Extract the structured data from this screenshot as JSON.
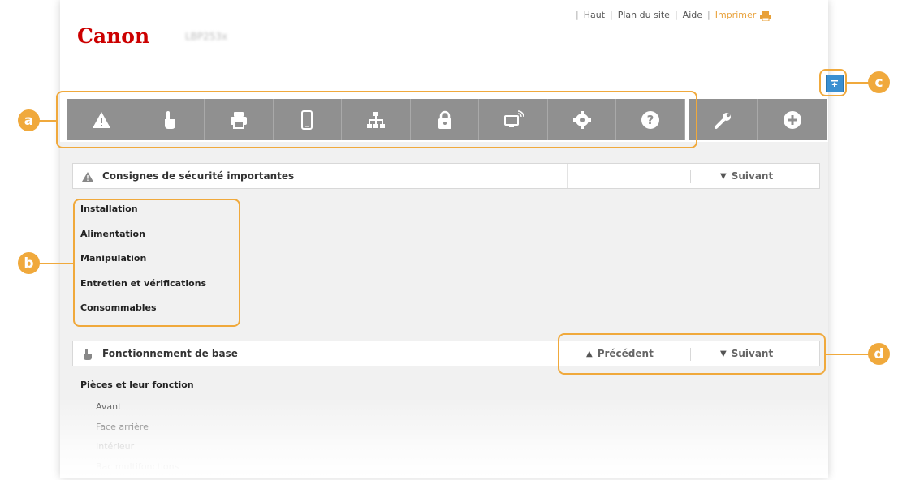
{
  "header": {
    "logo": "Canon",
    "model": "LBP253x",
    "links": [
      "Haut",
      "Plan du site",
      "Aide"
    ],
    "print_label": "Imprimer"
  },
  "toolbar": {
    "icons": [
      "warning-icon",
      "hand-pointer-icon",
      "printer-icon",
      "smartphone-icon",
      "network-icon",
      "lock-icon",
      "monitor-wireless-icon",
      "gear-icon",
      "help-icon",
      "wrench-icon",
      "plus-icon"
    ]
  },
  "section1": {
    "title": "Consignes de sécurité importantes",
    "next_label": "Suivant",
    "items": [
      "Installation",
      "Alimentation",
      "Manipulation",
      "Entretien et vérifications",
      "Consommables"
    ]
  },
  "section2": {
    "title": "Fonctionnement de base",
    "prev_label": "Précédent",
    "next_label": "Suivant",
    "subheading": "Pièces et leur fonction",
    "items": [
      "Avant",
      "Face arrière",
      "Intérieur",
      "Bac multifonctions"
    ]
  },
  "callouts": [
    "a",
    "b",
    "c",
    "d"
  ],
  "colors": {
    "accent": "#f0a93c",
    "brand": "#cc0000",
    "toolbar": "#909090",
    "scroll_button": "#3a8fd1"
  }
}
